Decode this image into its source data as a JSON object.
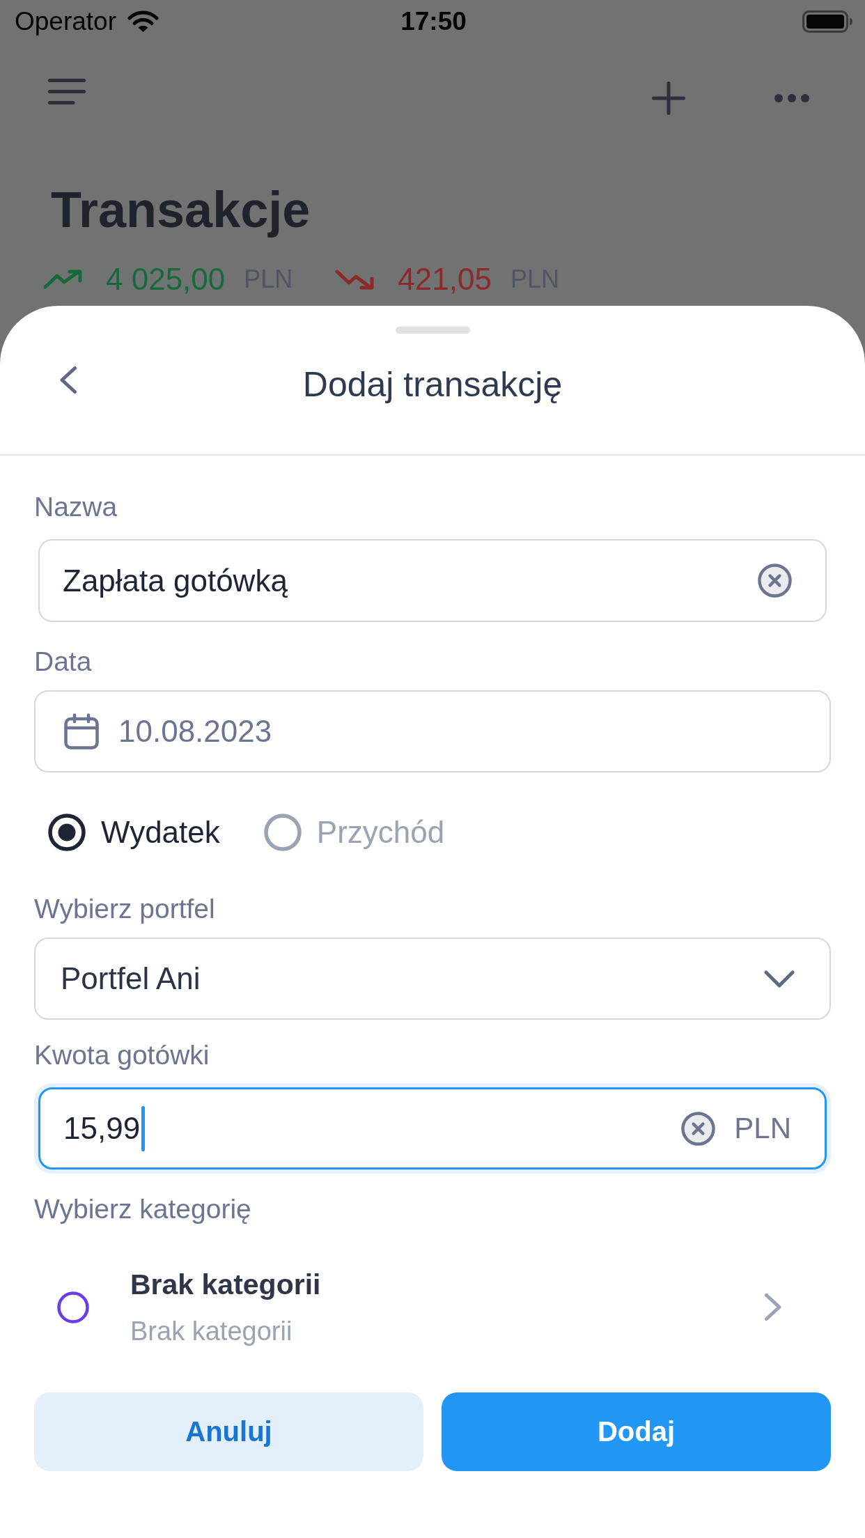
{
  "status_bar": {
    "carrier": "Operator",
    "time": "17:50"
  },
  "background_screen": {
    "title": "Transakcje",
    "summary": [
      {
        "kind": "income",
        "amount": "4 025,00",
        "currency": "PLN"
      },
      {
        "kind": "expense",
        "amount": "421,05",
        "currency": "PLN"
      }
    ]
  },
  "sheet": {
    "title": "Dodaj transakcję",
    "name_field": {
      "label": "Nazwa",
      "value": "Zapłata gotówką",
      "focused": false
    },
    "date_field": {
      "label": "Data",
      "value": "10.08.2023"
    },
    "type_options": [
      {
        "label": "Wydatek",
        "selected": true
      },
      {
        "label": "Przychód",
        "selected": false
      }
    ],
    "wallet_select": {
      "label": "Wybierz portfel",
      "value": "Portfel Ani"
    },
    "amount_field": {
      "label": "Kwota gotówki",
      "value": "15,99",
      "currency": "PLN",
      "focused": true
    },
    "category": {
      "label": "Wybierz kategorię",
      "name": "Brak kategorii",
      "description": "Brak kategorii",
      "color": "#6a3de8"
    },
    "buttons": [
      {
        "label": "Anuluj",
        "kind": "secondary"
      },
      {
        "label": "Dodaj",
        "kind": "primary"
      }
    ]
  }
}
